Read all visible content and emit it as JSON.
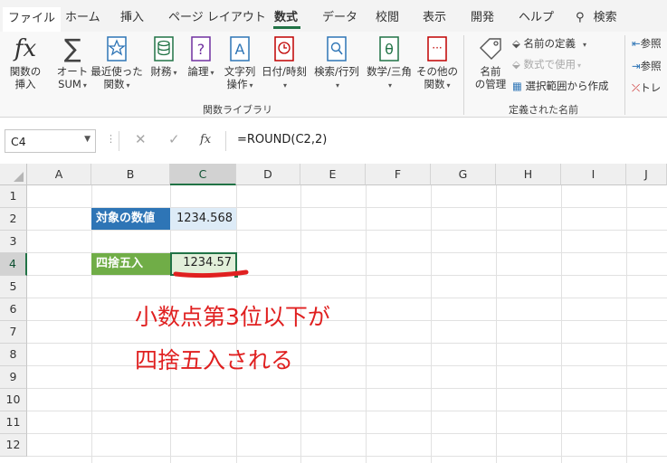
{
  "tabs": [
    "ファイル",
    "ホーム",
    "挿入",
    "ページ レイアウト",
    "数式",
    "データ",
    "校閲",
    "表示",
    "開発",
    "ヘルプ"
  ],
  "search_label": "検索",
  "ribbon": {
    "insert_function": [
      "関数の",
      "挿入"
    ],
    "autosum": [
      "オート",
      "SUM"
    ],
    "recent": [
      "最近使った",
      "関数"
    ],
    "financial": [
      "財務"
    ],
    "logical": [
      "論理"
    ],
    "text": [
      "文字列",
      "操作"
    ],
    "datetime": [
      "日付/時刻"
    ],
    "lookup": [
      "検索/行列"
    ],
    "math": [
      "数学/三角"
    ],
    "other": [
      "その他の",
      "関数"
    ],
    "name_manager": [
      "名前",
      "の管理"
    ],
    "define_name": "名前の定義",
    "use_in_formula": "数式で使用",
    "create_from_selection": "選択範囲から作成",
    "trace_prec": "参照",
    "trace_dep": "参照",
    "remove_arrows": "トレ",
    "group_library": "関数ライブラリ",
    "group_names": "定義された名前"
  },
  "formula_bar": {
    "name_box": "C4",
    "cancel": "✕",
    "enter": "✓",
    "fx": "fx",
    "formula": "=ROUND(C2,2)"
  },
  "columns": [
    "A",
    "B",
    "C",
    "D",
    "E",
    "F",
    "G",
    "H",
    "I",
    "J"
  ],
  "rows": [
    "1",
    "2",
    "3",
    "4",
    "5",
    "6",
    "7",
    "8",
    "9",
    "10",
    "11",
    "12"
  ],
  "cells": {
    "B2": "対象の数値",
    "C2": "1234.568",
    "B4": "四捨五入",
    "C4": "1234.57"
  },
  "annotation": {
    "line1": "小数点第3位以下が",
    "line2": "四捨五入される",
    "color": "#e02020"
  },
  "colors": {
    "accent": "#217346",
    "blue_label": "#2e75b6",
    "green_label": "#70ad47"
  }
}
